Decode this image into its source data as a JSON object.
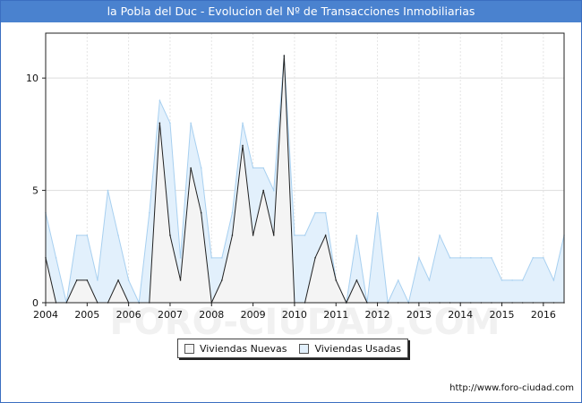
{
  "header": {
    "title": "la Pobla del Duc - Evolucion del Nº de Transacciones Inmobiliarias"
  },
  "watermark": "FORO-CIUDAD.COM",
  "footer": {
    "source": "http://www.foro-ciudad.com"
  },
  "colors": {
    "title_bg": "#4a82cf",
    "nuevas_fill": "#f4f4f4",
    "nuevas_line": "#222222",
    "usadas_fill": "#e2f0fc",
    "usadas_line": "#a8d0f0"
  },
  "chart_data": {
    "type": "area",
    "title": "la Pobla del Duc - Evolucion del Nº de Transacciones Inmobiliarias",
    "xlabel": "",
    "ylabel": "",
    "xlim": [
      2004,
      2016.5
    ],
    "ylim": [
      0,
      12
    ],
    "x_ticks": [
      2004,
      2005,
      2006,
      2007,
      2008,
      2009,
      2010,
      2011,
      2012,
      2013,
      2014,
      2015,
      2016
    ],
    "y_ticks": [
      0,
      5,
      10
    ],
    "grid": true,
    "legend_position": "bottom",
    "x": [
      2004.0,
      2004.25,
      2004.5,
      2004.75,
      2005.0,
      2005.25,
      2005.5,
      2005.75,
      2006.0,
      2006.25,
      2006.5,
      2006.75,
      2007.0,
      2007.25,
      2007.5,
      2007.75,
      2008.0,
      2008.25,
      2008.5,
      2008.75,
      2009.0,
      2009.25,
      2009.5,
      2009.75,
      2010.0,
      2010.25,
      2010.5,
      2010.75,
      2011.0,
      2011.25,
      2011.5,
      2011.75,
      2012.0,
      2012.25,
      2012.5,
      2012.75,
      2013.0,
      2013.25,
      2013.5,
      2013.75,
      2014.0,
      2014.25,
      2014.5,
      2014.75,
      2015.0,
      2015.25,
      2015.5,
      2015.75,
      2016.0,
      2016.25,
      2016.5
    ],
    "series": [
      {
        "name": "Viviendas Nuevas",
        "values": [
          2,
          0,
          0,
          1,
          1,
          0,
          0,
          1,
          0,
          0,
          0,
          8,
          3,
          1,
          6,
          4,
          0,
          1,
          3,
          7,
          3,
          5,
          3,
          11,
          0,
          0,
          2,
          3,
          1,
          0,
          1,
          0,
          0,
          0,
          0,
          0,
          0,
          0,
          0,
          0,
          0,
          0,
          0,
          0,
          0,
          0,
          0,
          0,
          0,
          0,
          0
        ]
      },
      {
        "name": "Viviendas Usadas",
        "values": [
          4,
          2,
          0,
          3,
          3,
          1,
          5,
          3,
          1,
          0,
          4,
          9,
          8,
          2,
          8,
          6,
          2,
          2,
          4,
          8,
          6,
          6,
          5,
          11,
          3,
          3,
          4,
          4,
          1,
          0,
          3,
          0,
          4,
          0,
          1,
          0,
          2,
          1,
          3,
          2,
          2,
          2,
          2,
          2,
          1,
          1,
          1,
          2,
          2,
          1,
          3
        ]
      }
    ]
  }
}
